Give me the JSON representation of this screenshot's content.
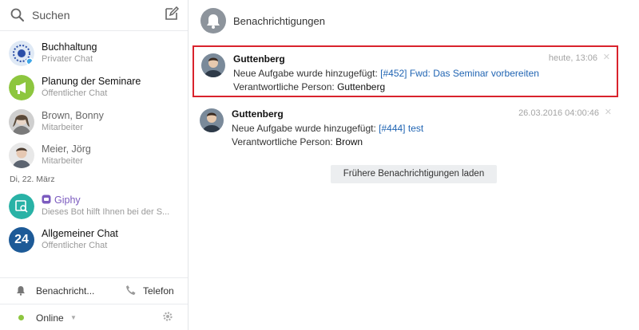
{
  "search": {
    "label": "Suchen"
  },
  "chats": [
    {
      "title": "Buchhaltung",
      "subtitle": "Privater Chat"
    },
    {
      "title": "Planung der Seminare",
      "subtitle": "Öffentlicher Chat"
    },
    {
      "title": "Brown, Bonny",
      "subtitle": "Mitarbeiter"
    },
    {
      "title": "Meier, Jörg",
      "subtitle": "Mitarbeiter"
    },
    {
      "title": "Giphy",
      "subtitle": "Dieses Bot hilft Ihnen bei der S..."
    },
    {
      "title": "Allgemeiner Chat",
      "subtitle": "Öffentlicher Chat",
      "avatar_text": "24"
    }
  ],
  "date_separator": "Di, 22. März",
  "sidebar_bottom": {
    "notifications": "Benachricht...",
    "phone": "Telefon",
    "status": "Online"
  },
  "main": {
    "title": "Benachrichtigungen",
    "notifications": [
      {
        "name": "Guttenberg",
        "time": "heute, 13:06",
        "prefix": "Neue Aufgabe wurde hinzugefügt:",
        "link": "[#452] Fwd: Das Seminar vorbereiten",
        "person_label": "Verantwortliche Person:",
        "person": "Guttenberg"
      },
      {
        "name": "Guttenberg",
        "time": "26.03.2016 04:00:46",
        "prefix": "Neue Aufgabe wurde hinzugefügt:",
        "link": "[#444] test",
        "person_label": "Verantwortliche Person:",
        "person": "Brown"
      }
    ],
    "load_more": "Frühere Benachrichtigungen laden"
  },
  "colors": {
    "highlight": "#d9232d",
    "link": "#2165b3",
    "online": "#8dc63f"
  }
}
